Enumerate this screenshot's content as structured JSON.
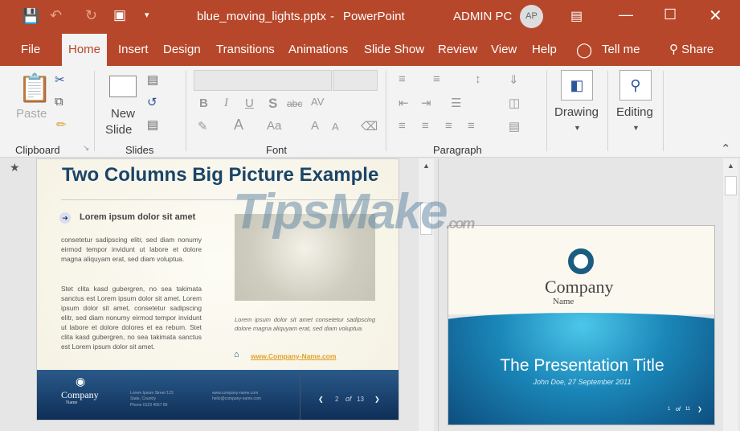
{
  "window": {
    "filename": "blue_moving_lights.pptx",
    "separator": "-",
    "app": "PowerPoint",
    "user": "ADMIN PC",
    "avatar": "AP"
  },
  "quick_access": [
    "save-icon",
    "undo-icon",
    "redo-icon",
    "present-icon",
    "customize-icon"
  ],
  "tabs": [
    "File",
    "Home",
    "Insert",
    "Design",
    "Transitions",
    "Animations",
    "Slide Show",
    "Review",
    "View",
    "Help"
  ],
  "tell_me": "Tell me",
  "share": "Share",
  "ribbon": {
    "clipboard": {
      "label": "Clipboard",
      "paste": "Paste"
    },
    "slides": {
      "label": "Slides",
      "new_slide_1": "New",
      "new_slide_2": "Slide"
    },
    "font": {
      "label": "Font",
      "bold": "B",
      "italic": "I",
      "underline": "U",
      "shadow": "S",
      "strike": "abc",
      "spacing": "AV",
      "color": "A",
      "case": "Aa",
      "grow": "A",
      "shrink": "A"
    },
    "paragraph": {
      "label": "Paragraph"
    },
    "drawing": "Drawing",
    "editing": "Editing"
  },
  "slide_main": {
    "title": "Two Columns Big Picture Example",
    "heading": "Lorem ipsum dolor sit amet",
    "para1": "consetetur sadipscing elitr, sed diam nonumy eirmod tempor invidunt ut labore et dolore magna aliquyam erat, sed diam voluptua.",
    "para2": "Stet clita kasd gubergren, no sea takimata sanctus est Lorem ipsum dolor sit amet. Lorem ipsum dolor sit amet, consetetur sadipscing elitr, sed diam nonumy eirmod tempor invidunt ut labore et dolore dolores et ea rebum. Stet clita kasd gubergren, no sea takimata sanctus est Lorem ipsum dolor sit amet.",
    "caption": "Lorem ipsum dolor sit amet consetetur sadipscing dolore magna aliquyam erat, sed diam voluptua.",
    "link": "www.Company-Name.com",
    "footer": {
      "company": "Company",
      "name": "Name",
      "addr1": "Lorem Ipsum Street 123",
      "addr2": "State, Country",
      "addr3": "Phone 0123 4567 89",
      "web": "www.company-name.com",
      "email": "hello@company-name.com",
      "page": "2",
      "of": "of",
      "total": "13"
    }
  },
  "slide_next": {
    "company": "Company",
    "name": "Name",
    "title": "The Presentation Title",
    "subtitle": "John Doe, 27 September 2011",
    "page": "1",
    "of": "of",
    "total": "11"
  },
  "watermark": {
    "main": "TipsMake",
    "suffix": ".com"
  }
}
